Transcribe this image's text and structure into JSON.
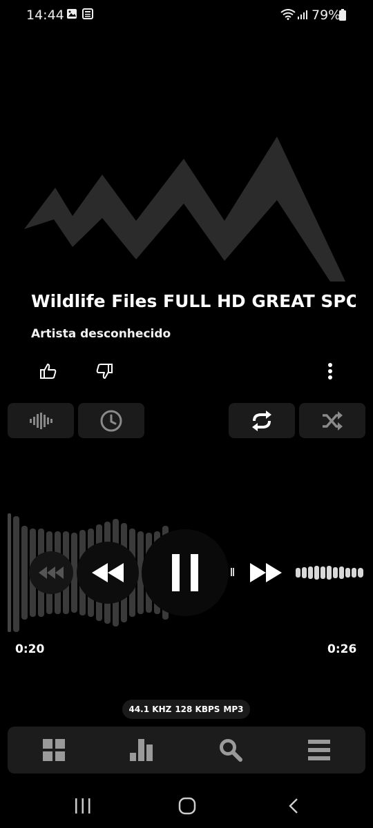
{
  "status_bar": {
    "time": "14:44",
    "battery": "79%",
    "icons": [
      "image-icon",
      "news-icon",
      "wifi-icon",
      "signal-icon",
      "battery-icon"
    ]
  },
  "track": {
    "title": "Wildlife Files FULL HD GREAT SPOT",
    "artist": "Artista desconhecido"
  },
  "player": {
    "elapsed": "0:20",
    "duration": "0:26",
    "progress": 0.77,
    "state": "playing"
  },
  "format": {
    "sample_rate": "44.1 KHZ",
    "bitrate": "128 KBPS",
    "codec": "MP3"
  },
  "colors": {
    "background": "#000000",
    "chip": "#1b1b1b",
    "artwork": "#2b2b2b",
    "accent": "#ffffff"
  }
}
